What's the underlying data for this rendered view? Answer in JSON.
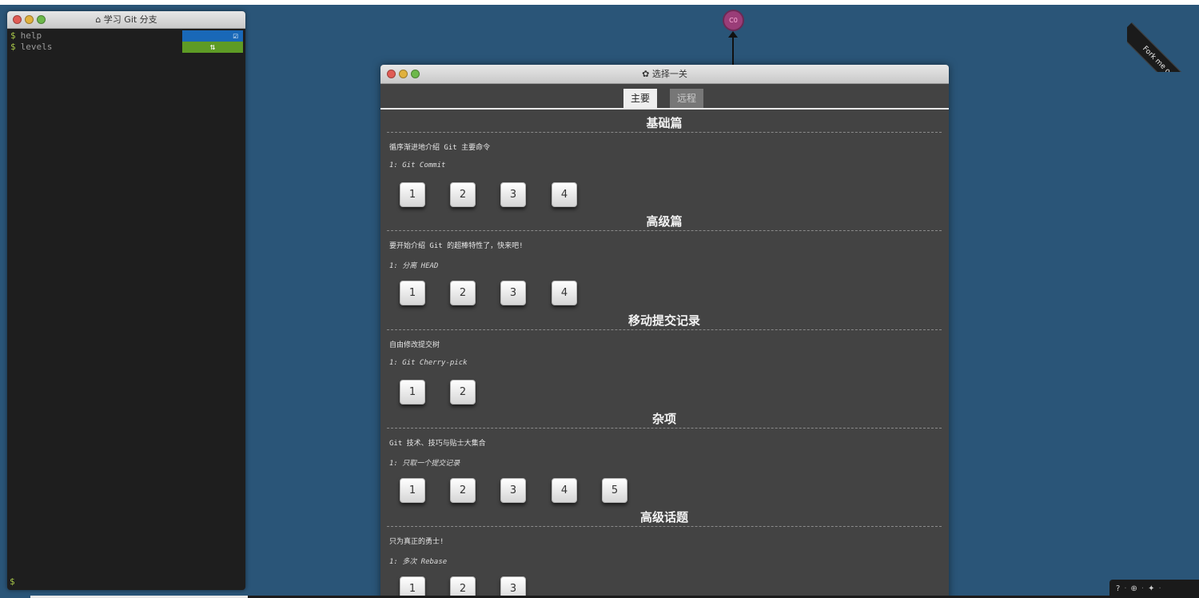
{
  "terminal": {
    "title": "学习 Git 分支",
    "home_icon": "home-icon",
    "lines": [
      {
        "prompt": "$",
        "cmd": "help",
        "badge_icon": "check-icon",
        "badge_glyph": "☑"
      },
      {
        "prompt": "$",
        "cmd": "levels",
        "badge_icon": "refresh-icon",
        "badge_glyph": "⇅"
      }
    ],
    "bottom_prompt": "$"
  },
  "commit": {
    "label": "C0"
  },
  "ribbon": {
    "text": "Fork me on GitHub"
  },
  "levels_window": {
    "title": "选择一关",
    "gear_icon": "gear-icon",
    "tabs": [
      {
        "label": "主要",
        "active": true
      },
      {
        "label": "远程",
        "active": false
      }
    ],
    "sections": [
      {
        "title": "基础篇",
        "desc": "循序渐进地介绍 Git 主要命令",
        "sub": "1: Git Commit",
        "levels": [
          "1",
          "2",
          "3",
          "4"
        ]
      },
      {
        "title": "高级篇",
        "desc": "要开始介绍 Git 的超棒特性了，快来吧!",
        "sub": "1: 分离 HEAD",
        "levels": [
          "1",
          "2",
          "3",
          "4"
        ]
      },
      {
        "title": "移动提交记录",
        "desc": "自由修改提交树",
        "sub": "1: Git Cherry-pick",
        "levels": [
          "1",
          "2"
        ]
      },
      {
        "title": "杂项",
        "desc": "Git 技术、技巧与贴士大集合",
        "sub": "1: 只取一个提交记录",
        "levels": [
          "1",
          "2",
          "3",
          "4",
          "5"
        ]
      },
      {
        "title": "高级话题",
        "desc": "只为真正的勇士!",
        "sub": "1: 多次 Rebase",
        "levels": [
          "1",
          "2",
          "3"
        ]
      }
    ]
  },
  "toolbar": {
    "items": [
      "help-icon",
      "globe-icon",
      "twitter-icon",
      "more-icon"
    ],
    "glyphs": {
      "help": "?",
      "globe": "⊕",
      "twitter": "✦",
      "sep": "·"
    }
  }
}
